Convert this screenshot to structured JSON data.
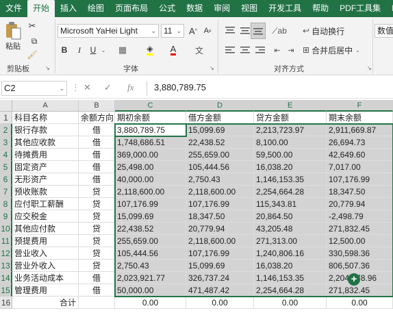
{
  "ribbon_tabs": [
    "文件",
    "开始",
    "插入",
    "绘图",
    "页面布局",
    "公式",
    "数据",
    "审阅",
    "视图",
    "开发工具",
    "帮助",
    "PDF工具集",
    "P"
  ],
  "ribbon": {
    "paste_label": "粘贴",
    "clipboard_group": "剪贴板",
    "font_group": "字体",
    "align_group": "对齐方式",
    "font_name": "Microsoft YaHei Light",
    "font_size": "11",
    "bold": "B",
    "italic": "I",
    "underline": "U",
    "grow_font": "A",
    "shrink_font": "A",
    "font_color_glyph": "A",
    "wrap_text": "自动换行",
    "merge_center": "合并后居中",
    "number_format": "数值",
    "launcher_glyph": "↘",
    "align_launcher_glyph": "↘"
  },
  "formula_bar": {
    "name_box": "C2",
    "formula": "3,880,789.75",
    "fx": "fx"
  },
  "columns": [
    "A",
    "B",
    "C",
    "D",
    "E",
    "F"
  ],
  "rows": [
    {
      "num": "1",
      "cells": [
        "科目名称",
        "余额方向",
        "期初余额",
        "借方金额",
        "贷方金额",
        "期末余额"
      ]
    },
    {
      "num": "2",
      "cells": [
        "银行存款",
        "借",
        "3,880,789.75",
        "15,099.69",
        "2,213,723.97",
        "2,911,669.87"
      ]
    },
    {
      "num": "3",
      "cells": [
        "其他应收款",
        "借",
        "1,748,686.51",
        "22,438.52",
        "8,100.00",
        "26,694.73"
      ]
    },
    {
      "num": "4",
      "cells": [
        "待摊费用",
        "借",
        "369,000.00",
        "255,659.00",
        "59,500.00",
        "42,649.60"
      ]
    },
    {
      "num": "5",
      "cells": [
        "固定资产",
        "借",
        "25,498.00",
        "105,444.56",
        "16,038.20",
        "7,017.00"
      ]
    },
    {
      "num": "6",
      "cells": [
        "无形资产",
        "借",
        "40,000.00",
        "2,750.43",
        "1,146,153.35",
        "107,176.99"
      ]
    },
    {
      "num": "7",
      "cells": [
        "预收账款",
        "贷",
        "2,118,600.00",
        "2,118,600.00",
        "2,254,664.28",
        "18,347.50"
      ]
    },
    {
      "num": "8",
      "cells": [
        "应付职工薪酬",
        "贷",
        "107,176.99",
        "107,176.99",
        "115,343.81",
        "20,779.94"
      ]
    },
    {
      "num": "9",
      "cells": [
        "应交税金",
        "贷",
        "15,099.69",
        "18,347.50",
        "20,864.50",
        "-2,498.79"
      ]
    },
    {
      "num": "10",
      "cells": [
        "其他应付款",
        "贷",
        "22,438.52",
        "20,779.94",
        "43,205.48",
        "271,832.45"
      ]
    },
    {
      "num": "11",
      "cells": [
        "预提费用",
        "贷",
        "255,659.00",
        "2,118,600.00",
        "271,313.00",
        "12,500.00"
      ]
    },
    {
      "num": "12",
      "cells": [
        "营业收入",
        "贷",
        "105,444.56",
        "107,176.99",
        "1,240,806.16",
        "330,598.36"
      ]
    },
    {
      "num": "13",
      "cells": [
        "营业外收入",
        "贷",
        "2,750.43",
        "15,099.69",
        "16,038.20",
        "806,507.36"
      ]
    },
    {
      "num": "14",
      "cells": [
        "业务活动成本",
        "借",
        "2,023,921.77",
        "326,737.24",
        "1,146,153.35",
        "2,204,078.96"
      ]
    },
    {
      "num": "15",
      "cells": [
        "管理费用",
        "借",
        "50,000.00",
        "471,487.42",
        "2,254,664.28",
        "271,832.45"
      ]
    },
    {
      "num": "16",
      "cells": [
        "合计",
        "",
        "0.00",
        "0.00",
        "0.00",
        "0.00"
      ]
    }
  ],
  "colors": {
    "accent": "#217346",
    "selection": "#d3d3d3"
  }
}
